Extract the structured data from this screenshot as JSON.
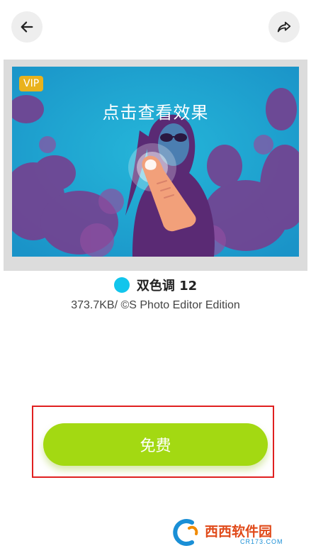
{
  "toolbar": {
    "back_icon": "arrow-left-icon",
    "share_icon": "share-arrow-icon"
  },
  "preview": {
    "vip_badge": "VIP",
    "tap_hint": "点击查看效果",
    "hand_icon": "tap-hand-icon"
  },
  "filter": {
    "name": "双色调 12",
    "dot_color": "#12c5ec",
    "meta": "373.7KB/ ©S Photo Editor Edition"
  },
  "action": {
    "free_label": "免费",
    "button_color": "#a3d912",
    "highlight_color": "#e02020"
  },
  "watermark": {
    "logo": "cr173-logo",
    "brand_text": "西西软件园",
    "site_text": "CR173.COM"
  }
}
